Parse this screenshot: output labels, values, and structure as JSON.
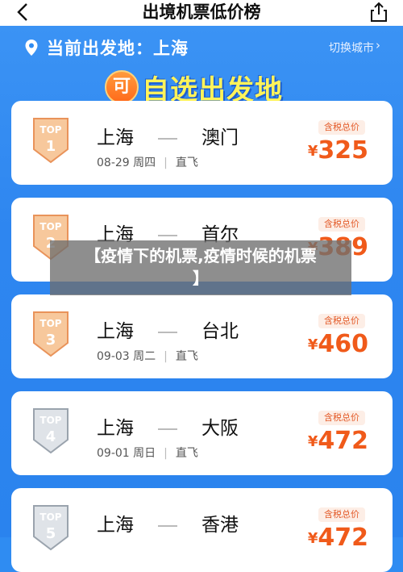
{
  "header": {
    "title": "出境机票低价榜"
  },
  "location": {
    "text": "当前出发地：上海",
    "switch_label": "切换城市",
    "switch_arrow": "›"
  },
  "banner": {
    "badge": "可",
    "text": "自选出发地"
  },
  "routes": [
    {
      "rank_label": "TOP",
      "rank": "1",
      "from": "上海",
      "to": "澳门",
      "date": "08-29",
      "weekday": "周四",
      "type": "直飞",
      "tag": "含税总价",
      "currency": "¥",
      "price": "325"
    },
    {
      "rank_label": "TOP",
      "rank": "2",
      "from": "上海",
      "to": "首尔",
      "date": "",
      "weekday": "",
      "type": "",
      "tag": "含税总价",
      "currency": "¥",
      "price": "389"
    },
    {
      "rank_label": "TOP",
      "rank": "3",
      "from": "上海",
      "to": "台北",
      "date": "09-03",
      "weekday": "周二",
      "type": "直飞",
      "tag": "含税总价",
      "currency": "¥",
      "price": "460"
    },
    {
      "rank_label": "TOP",
      "rank": "4",
      "from": "上海",
      "to": "大阪",
      "date": "09-01",
      "weekday": "周日",
      "type": "直飞",
      "tag": "含税总价",
      "currency": "¥",
      "price": "472"
    },
    {
      "rank_label": "TOP",
      "rank": "5",
      "from": "上海",
      "to": "香港",
      "date": "",
      "weekday": "",
      "type": "",
      "tag": "含税总价",
      "currency": "¥",
      "price": "472"
    }
  ],
  "overlay": {
    "line1": "【疫情下的机票,疫情时候的机票",
    "line2": "】"
  },
  "colors": {
    "accent": "#2f8cf2",
    "price": "#f05a1a",
    "banner_text": "#fff35a"
  }
}
